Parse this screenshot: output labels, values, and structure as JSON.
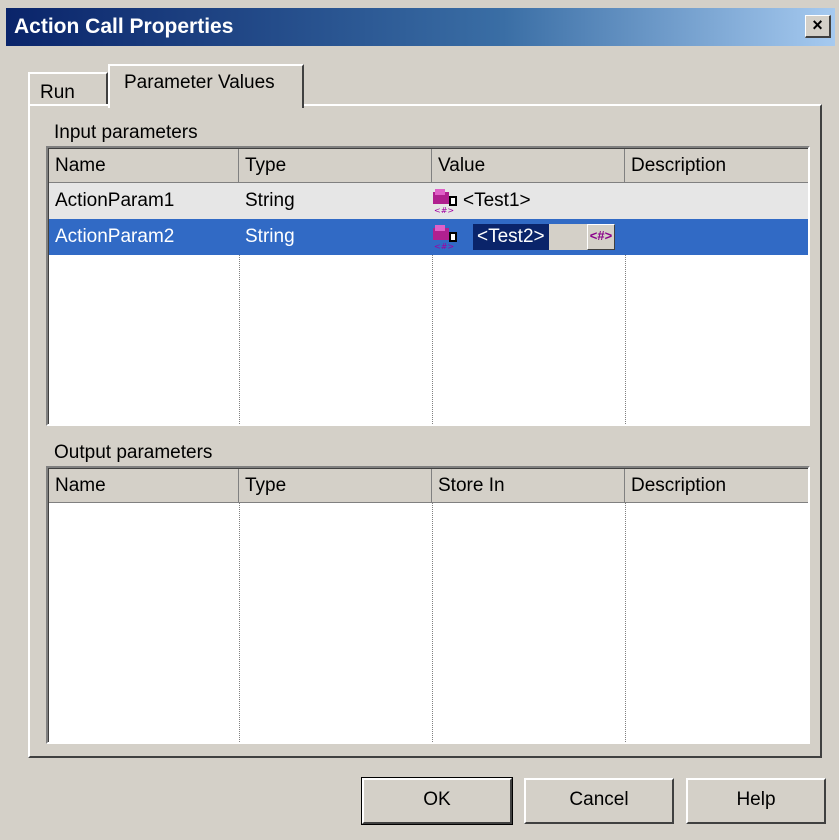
{
  "window": {
    "title": "Action Call Properties",
    "close_label": "×"
  },
  "tabs": [
    {
      "label": "Run",
      "active": false
    },
    {
      "label": "Parameter Values",
      "active": true
    }
  ],
  "input_params": {
    "label": "Input parameters",
    "headers": [
      "Name",
      "Type",
      "Value",
      "Description"
    ],
    "rows": [
      {
        "name": "ActionParam1",
        "type": "String",
        "value": "<Test1>",
        "description": "",
        "icon": "parameter-icon"
      },
      {
        "name": "ActionParam2",
        "type": "String",
        "value": "<Test2>",
        "description": "",
        "icon": "parameter-icon",
        "selected": true
      }
    ],
    "value_button_label": "<#>"
  },
  "output_params": {
    "label": "Output parameters",
    "headers": [
      "Name",
      "Type",
      "Store In",
      "Description"
    ],
    "rows": []
  },
  "buttons": {
    "ok": "OK",
    "cancel": "Cancel",
    "help": "Help"
  },
  "colors": {
    "title_start": "#0a246a",
    "title_end": "#a6caf0",
    "selection": "#316ac5",
    "face": "#d4d0c8"
  }
}
